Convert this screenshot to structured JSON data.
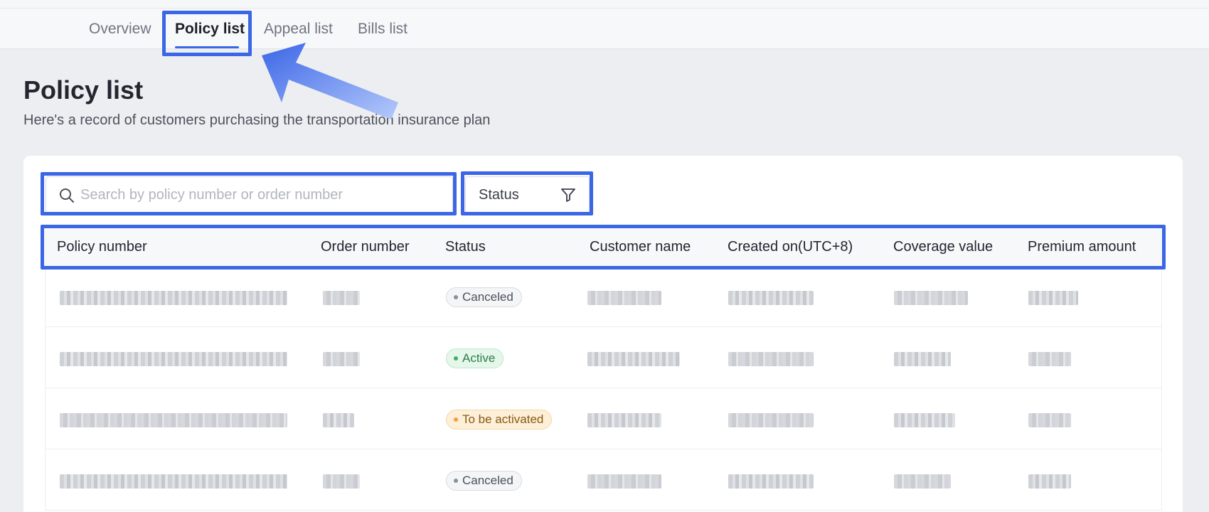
{
  "tabs": [
    {
      "label": "Overview"
    },
    {
      "label": "Policy list"
    },
    {
      "label": "Appeal list"
    },
    {
      "label": "Bills list"
    }
  ],
  "page": {
    "title": "Policy list",
    "subtitle": "Here's a record of customers purchasing the transportation insurance plan"
  },
  "search": {
    "placeholder": "Search by policy number or order number",
    "value": ""
  },
  "status_filter": {
    "label": "Status"
  },
  "table": {
    "columns": [
      "Policy number",
      "Order number",
      "Status",
      "Customer name",
      "Created on(UTC+8)",
      "Coverage value",
      "Premium amount"
    ],
    "rows": [
      {
        "status": "Canceled"
      },
      {
        "status": "Active"
      },
      {
        "status": "To be activated"
      },
      {
        "status": "Canceled"
      }
    ]
  },
  "colors": {
    "accent": "#3b66e6",
    "highlight": "#3b66e6",
    "active": "#3fae66",
    "pending": "#f0a23b",
    "canceled": "#8b8f99"
  },
  "icons": {
    "search": "search-icon",
    "filter": "filter-icon",
    "annotation_arrow": "arrow-icon"
  }
}
